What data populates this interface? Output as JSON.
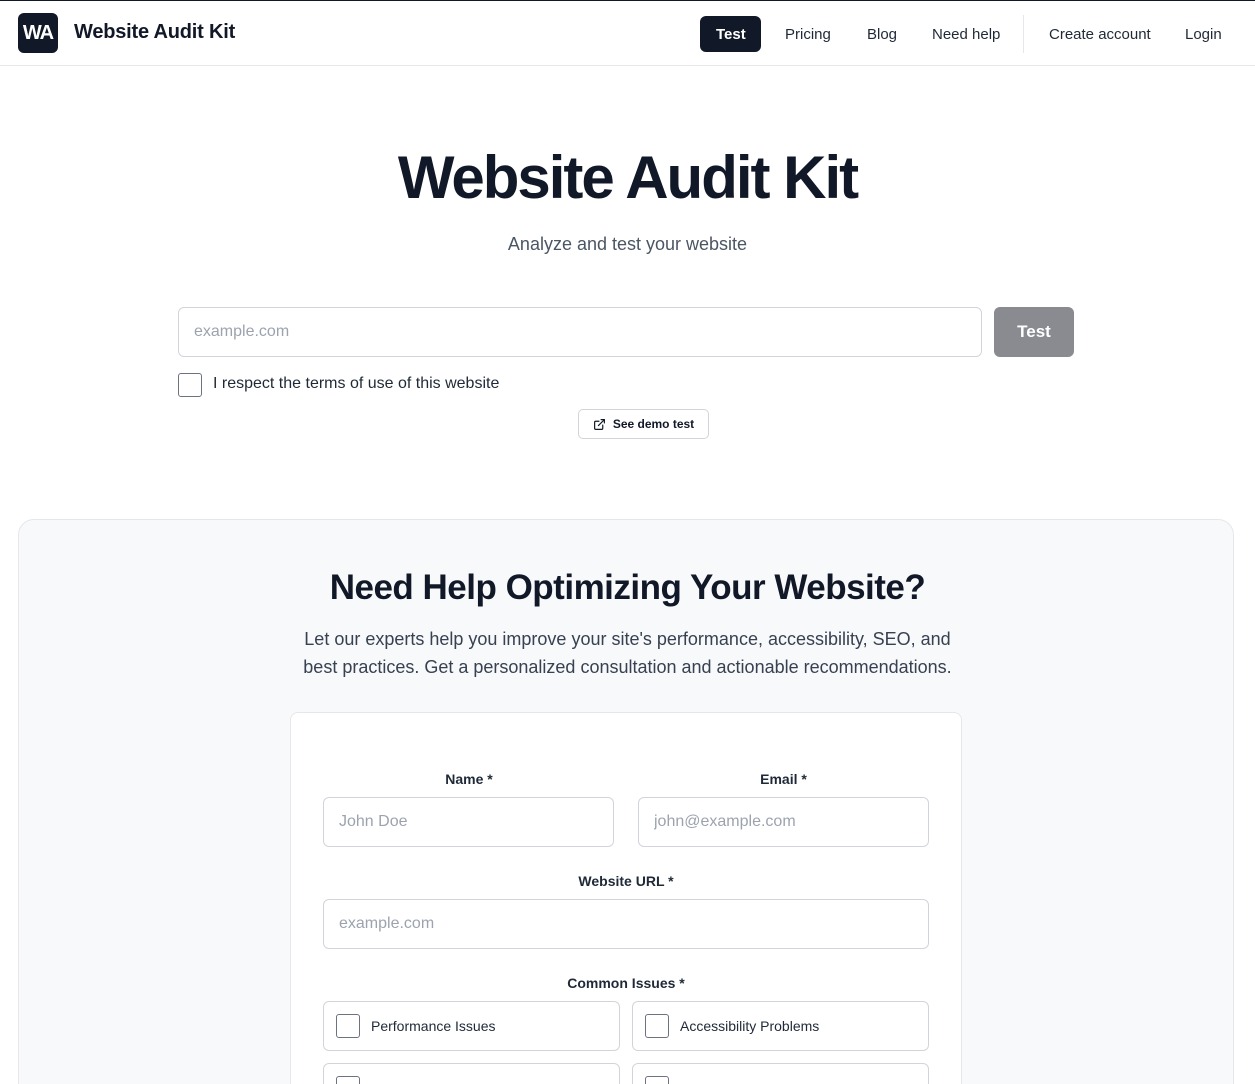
{
  "header": {
    "logo_text": "WA",
    "brand": "Website Audit Kit",
    "nav": [
      {
        "label": "Test",
        "active": true
      },
      {
        "label": "Pricing"
      },
      {
        "label": "Blog"
      },
      {
        "label": "Need help"
      },
      {
        "label": "Create account"
      },
      {
        "label": "Login"
      }
    ]
  },
  "hero": {
    "title": "Website Audit Kit",
    "subtitle": "Analyze and test your website",
    "url_placeholder": "example.com",
    "url_value": "",
    "test_button": "Test",
    "terms_label": "I respect the terms of use of this website",
    "terms_checked": false,
    "demo_button": "See demo test",
    "demo_icon": "external-link-icon"
  },
  "help": {
    "title": "Need Help Optimizing Your Website?",
    "description": "Let our experts help you improve your site's performance, accessibility, SEO, and best practices. Get a personalized consultation and actionable recommendations.",
    "form": {
      "name_label": "Name *",
      "name_placeholder": "John Doe",
      "email_label": "Email *",
      "email_placeholder": "john@example.com",
      "website_label": "Website URL *",
      "website_placeholder": "example.com",
      "issues_label": "Common Issues *",
      "issues": [
        {
          "label": "Performance Issues",
          "checked": false
        },
        {
          "label": "Accessibility Problems",
          "checked": false
        },
        {
          "label": "",
          "checked": false
        },
        {
          "label": "",
          "checked": false
        }
      ]
    }
  },
  "colors": {
    "primary": "#111827",
    "button_disabled": "#898b91",
    "section_bg": "#f8f9fb",
    "border": "#d1d5db"
  }
}
